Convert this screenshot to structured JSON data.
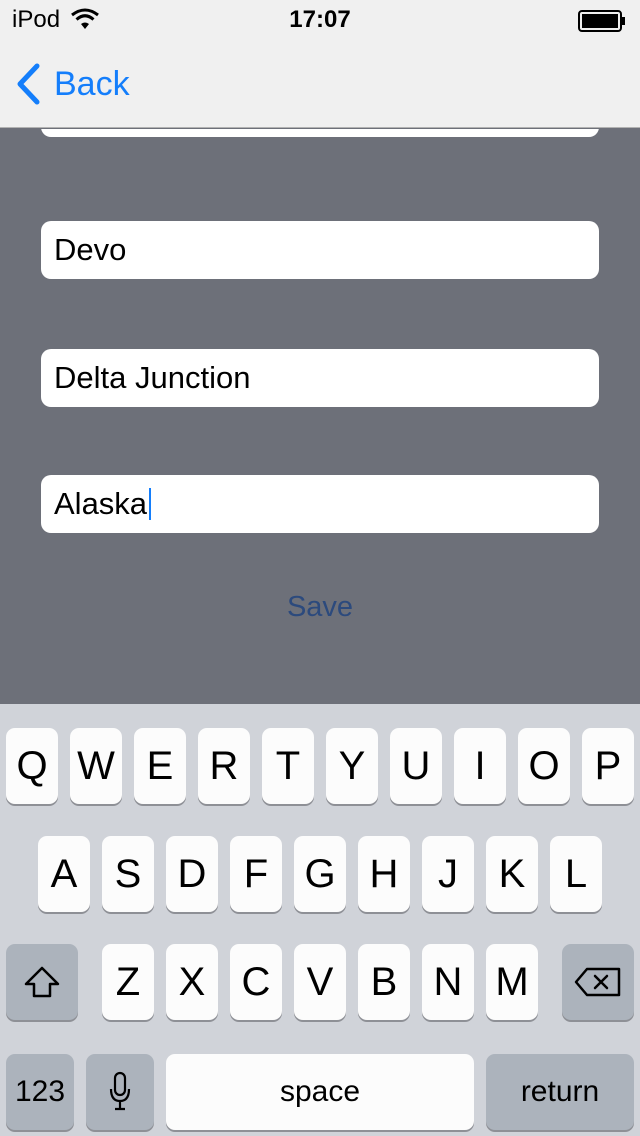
{
  "status_bar": {
    "carrier": "iPod",
    "time": "17:07"
  },
  "nav": {
    "back_label": "Back"
  },
  "form": {
    "fields": [
      {
        "value": "Devo"
      },
      {
        "value": "Delta Junction"
      },
      {
        "value": "Alaska"
      }
    ],
    "save_label": "Save"
  },
  "keyboard": {
    "row1": [
      "Q",
      "W",
      "E",
      "R",
      "T",
      "Y",
      "U",
      "I",
      "O",
      "P"
    ],
    "row2": [
      "A",
      "S",
      "D",
      "F",
      "G",
      "H",
      "J",
      "K",
      "L"
    ],
    "row3": [
      "Z",
      "X",
      "C",
      "V",
      "B",
      "N",
      "M"
    ],
    "numbers_label": "123",
    "space_label": "space",
    "return_label": "return"
  },
  "icons": {
    "wifi": "wifi-icon",
    "battery": "battery-icon",
    "back": "chevron-left-icon",
    "shift": "shift-icon",
    "delete": "backspace-icon",
    "dictation": "microphone-icon"
  },
  "colors": {
    "accent": "#147efb",
    "background": "#6d7079",
    "save_text": "#2c4a7d",
    "keyboard_bg": "#d0d3d9"
  }
}
